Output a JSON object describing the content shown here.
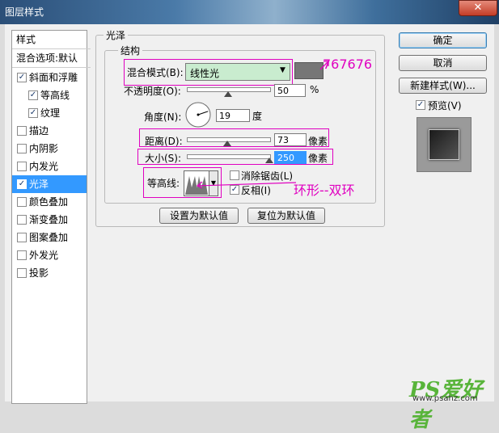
{
  "window": {
    "title": "图层样式",
    "close_glyph": "✕"
  },
  "left_panel": {
    "header": "样式",
    "blend_options": "混合选项:默认",
    "items": [
      {
        "label": "斜面和浮雕",
        "checked": true,
        "indent": false,
        "selected": false
      },
      {
        "label": "等高线",
        "checked": true,
        "indent": true,
        "selected": false
      },
      {
        "label": "纹理",
        "checked": true,
        "indent": true,
        "selected": false
      },
      {
        "label": "描边",
        "checked": false,
        "indent": false,
        "selected": false
      },
      {
        "label": "内阴影",
        "checked": false,
        "indent": false,
        "selected": false
      },
      {
        "label": "内发光",
        "checked": false,
        "indent": false,
        "selected": false
      },
      {
        "label": "光泽",
        "checked": true,
        "indent": false,
        "selected": true
      },
      {
        "label": "颜色叠加",
        "checked": false,
        "indent": false,
        "selected": false
      },
      {
        "label": "渐变叠加",
        "checked": false,
        "indent": false,
        "selected": false
      },
      {
        "label": "图案叠加",
        "checked": false,
        "indent": false,
        "selected": false
      },
      {
        "label": "外发光",
        "checked": false,
        "indent": false,
        "selected": false
      },
      {
        "label": "投影",
        "checked": false,
        "indent": false,
        "selected": false
      }
    ]
  },
  "satin": {
    "group_title": "光泽",
    "structure_title": "结构",
    "blend_mode_label": "混合模式(B):",
    "blend_mode_value": "线性光",
    "color_swatch": "#767676",
    "opacity_label": "不透明度(O):",
    "opacity_value": "50",
    "opacity_unit": "%",
    "angle_label": "角度(N):",
    "angle_value": "19",
    "angle_unit": "度",
    "distance_label": "距离(D):",
    "distance_value": "73",
    "distance_unit": "像素",
    "size_label": "大小(S):",
    "size_value": "250",
    "size_unit": "像素",
    "contour_label": "等高线:",
    "anti_alias_label": "消除锯齿(L)",
    "anti_alias_checked": false,
    "invert_label": "反相(I)",
    "invert_checked": true,
    "make_default": "设置为默认值",
    "reset_default": "复位为默认值"
  },
  "right_panel": {
    "ok": "确定",
    "cancel": "取消",
    "new_style": "新建样式(W)...",
    "preview_label": "预览(V)",
    "preview_checked": true
  },
  "annotations": {
    "color_note": "767676",
    "contour_note": "环形--双环"
  },
  "watermark": {
    "brand": "PS爱好者",
    "url": "www.psahz.com"
  },
  "colors": {
    "accent": "#3399ff",
    "annotation": "#e000c0",
    "highlight": "#c9eccf"
  }
}
